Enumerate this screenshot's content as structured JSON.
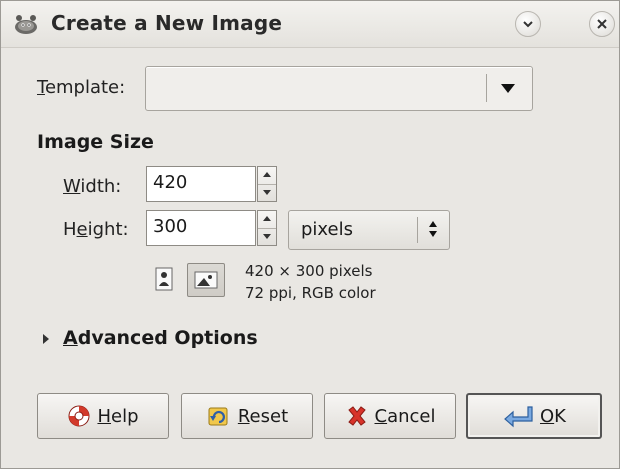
{
  "window": {
    "title": "Create a New Image",
    "icons": {
      "app": "gimp-wilber-icon",
      "minimize": "chevron-down-icon",
      "close": "close-icon"
    }
  },
  "template": {
    "label_mnemonic": "T",
    "label_rest": "emplate:",
    "selected_value": ""
  },
  "image_size": {
    "section_title": "Image Size",
    "width": {
      "label_mnemonic": "W",
      "label_rest": "idth:",
      "value": "420"
    },
    "height": {
      "label_prefix": "H",
      "label_mnemonic": "e",
      "label_rest": "ight:",
      "value": "300"
    },
    "units": {
      "selected": "pixels"
    },
    "orientation": {
      "selected": "landscape"
    },
    "info_line1": "420 × 300 pixels",
    "info_line2": "72 ppi, RGB color"
  },
  "advanced": {
    "label_mnemonic": "A",
    "label_rest": "dvanced Options",
    "expanded": false
  },
  "buttons": {
    "help": {
      "mnemonic": "H",
      "rest": "elp",
      "icon": "lifebuoy-icon"
    },
    "reset": {
      "mnemonic": "R",
      "rest": "eset",
      "icon": "reset-icon"
    },
    "cancel": {
      "mnemonic": "C",
      "rest": "ancel",
      "icon": "cancel-x-icon"
    },
    "ok": {
      "mnemonic": "O",
      "rest": "K",
      "icon": "enter-arrow-icon"
    }
  },
  "colors": {
    "background": "#e9e7e3",
    "help_icon": "#d23a2b",
    "reset_icon": "#e9b93c",
    "cancel_icon": "#d8332a",
    "ok_icon": "#3a77c4"
  }
}
